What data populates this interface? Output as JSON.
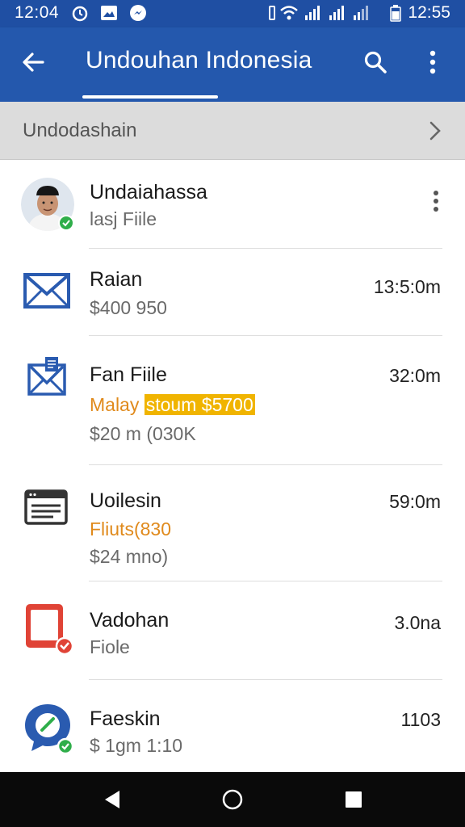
{
  "status_bar": {
    "time_left": "12:04",
    "time_right": "12:55"
  },
  "app_bar": {
    "title": "Undouhan Indonesia"
  },
  "section": {
    "label": "Undodashain"
  },
  "items": [
    {
      "title": "Undaiahassa",
      "subtitle": "lasj Fiile",
      "icon": "avatar-icon"
    },
    {
      "title": "Raian",
      "subtitle": "$400 950",
      "time": "13:5:0m",
      "icon": "mail-icon"
    },
    {
      "title": "Fan Fiile",
      "accent": "Malay",
      "accent_highlight": "stoum $5700",
      "subtitle": "$20 m (030K",
      "time": "32:0m",
      "icon": "mail-attachment-icon"
    },
    {
      "title": "Uoilesin",
      "accent": "Fliuts(830",
      "subtitle": "$24 mno)",
      "time": "59:0m",
      "icon": "document-list-icon"
    },
    {
      "title": "Vadohan",
      "subtitle": "Fiole",
      "time": "3.0na",
      "icon": "red-app-icon"
    },
    {
      "title": "Faeskin",
      "subtitle": "$ 1gm 1:10",
      "time": "1103",
      "icon": "chat-bubble-icon"
    }
  ],
  "colors": {
    "app_bar": "#2458ad",
    "status_bar": "#1f4fa3",
    "accent_orange": "#e08a1c",
    "highlight": "#f0b400"
  }
}
